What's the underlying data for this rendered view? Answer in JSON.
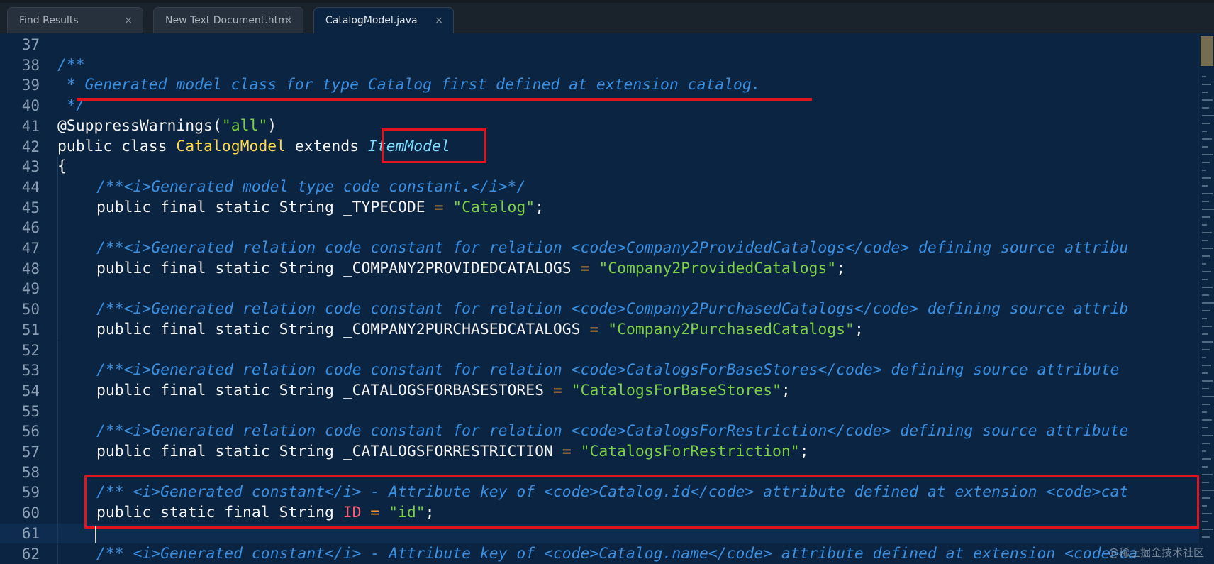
{
  "tabs": [
    {
      "label": "Find Results",
      "close": "×",
      "active": false
    },
    {
      "label": "New Text Document.html",
      "close": "×",
      "active": false
    },
    {
      "label": "CatalogModel.java",
      "close": "×",
      "active": true
    }
  ],
  "lines": [
    {
      "n": "37",
      "tokens": []
    },
    {
      "n": "38",
      "tokens": [
        {
          "t": "/**",
          "c": "c"
        }
      ]
    },
    {
      "n": "39",
      "tokens": [
        {
          "t": " * Generated model class for type Catalog first defined at extension catalog.",
          "c": "c"
        }
      ]
    },
    {
      "n": "40",
      "tokens": [
        {
          "t": " */",
          "c": "c"
        }
      ]
    },
    {
      "n": "41",
      "tokens": [
        {
          "t": "@SuppressWarnings(",
          "c": "k"
        },
        {
          "t": "\"all\"",
          "c": "s"
        },
        {
          "t": ")",
          "c": "k"
        }
      ]
    },
    {
      "n": "42",
      "tokens": [
        {
          "t": "public class ",
          "c": "k"
        },
        {
          "t": "CatalogModel",
          "c": "t"
        },
        {
          "t": " extends ",
          "c": "k"
        },
        {
          "t": "ItemModel",
          "c": "i"
        }
      ]
    },
    {
      "n": "43",
      "tokens": [
        {
          "t": "{",
          "c": "k"
        }
      ]
    },
    {
      "n": "44",
      "indent": true,
      "tokens": [
        {
          "t": "/**<i>Generated model type code constant.</i>*/",
          "c": "c"
        }
      ]
    },
    {
      "n": "45",
      "indent": true,
      "tokens": [
        {
          "t": "public final static String _TYPECODE ",
          "c": "k"
        },
        {
          "t": "=",
          "c": "o"
        },
        {
          "t": " ",
          "c": "k"
        },
        {
          "t": "\"Catalog\"",
          "c": "s"
        },
        {
          "t": ";",
          "c": "k"
        }
      ]
    },
    {
      "n": "46",
      "tokens": []
    },
    {
      "n": "47",
      "indent": true,
      "tokens": [
        {
          "t": "/**<i>Generated relation code constant for relation <code>Company2ProvidedCatalogs</code> defining source attribu",
          "c": "c"
        }
      ]
    },
    {
      "n": "48",
      "indent": true,
      "tokens": [
        {
          "t": "public final static String _COMPANY2PROVIDEDCATALOGS ",
          "c": "k"
        },
        {
          "t": "=",
          "c": "o"
        },
        {
          "t": " ",
          "c": "k"
        },
        {
          "t": "\"Company2ProvidedCatalogs\"",
          "c": "s"
        },
        {
          "t": ";",
          "c": "k"
        }
      ]
    },
    {
      "n": "49",
      "tokens": []
    },
    {
      "n": "50",
      "indent": true,
      "tokens": [
        {
          "t": "/**<i>Generated relation code constant for relation <code>Company2PurchasedCatalogs</code> defining source attrib",
          "c": "c"
        }
      ]
    },
    {
      "n": "51",
      "indent": true,
      "tokens": [
        {
          "t": "public final static String _COMPANY2PURCHASEDCATALOGS ",
          "c": "k"
        },
        {
          "t": "=",
          "c": "o"
        },
        {
          "t": " ",
          "c": "k"
        },
        {
          "t": "\"Company2PurchasedCatalogs\"",
          "c": "s"
        },
        {
          "t": ";",
          "c": "k"
        }
      ]
    },
    {
      "n": "52",
      "tokens": []
    },
    {
      "n": "53",
      "indent": true,
      "tokens": [
        {
          "t": "/**<i>Generated relation code constant for relation <code>CatalogsForBaseStores</code> defining source attribute ",
          "c": "c"
        }
      ]
    },
    {
      "n": "54",
      "indent": true,
      "tokens": [
        {
          "t": "public final static String _CATALOGSFORBASESTORES ",
          "c": "k"
        },
        {
          "t": "=",
          "c": "o"
        },
        {
          "t": " ",
          "c": "k"
        },
        {
          "t": "\"CatalogsForBaseStores\"",
          "c": "s"
        },
        {
          "t": ";",
          "c": "k"
        }
      ]
    },
    {
      "n": "55",
      "tokens": []
    },
    {
      "n": "56",
      "indent": true,
      "tokens": [
        {
          "t": "/**<i>Generated relation code constant for relation <code>CatalogsForRestriction</code> defining source attribute ",
          "c": "c"
        }
      ]
    },
    {
      "n": "57",
      "indent": true,
      "tokens": [
        {
          "t": "public final static String _CATALOGSFORRESTRICTION ",
          "c": "k"
        },
        {
          "t": "=",
          "c": "o"
        },
        {
          "t": " ",
          "c": "k"
        },
        {
          "t": "\"CatalogsForRestriction\"",
          "c": "s"
        },
        {
          "t": ";",
          "c": "k"
        }
      ]
    },
    {
      "n": "58",
      "tokens": []
    },
    {
      "n": "59",
      "indent": true,
      "tokens": [
        {
          "t": "/** <i>Generated constant</i> - Attribute key of <code>Catalog.id</code> attribute defined at extension <code>cat",
          "c": "c"
        }
      ]
    },
    {
      "n": "60",
      "indent": true,
      "tokens": [
        {
          "t": "public static final String ",
          "c": "k"
        },
        {
          "t": "ID",
          "c": "f"
        },
        {
          "t": " ",
          "c": "k"
        },
        {
          "t": "=",
          "c": "o"
        },
        {
          "t": " ",
          "c": "k"
        },
        {
          "t": "\"id\"",
          "c": "s"
        },
        {
          "t": ";",
          "c": "k"
        }
      ]
    },
    {
      "n": "61",
      "current": true,
      "tokens": []
    },
    {
      "n": "62",
      "indent": true,
      "tokens": [
        {
          "t": "/** <i>Generated constant</i> - Attribute key of <code>Catalog.name</code> attribute defined at extension <code>ca",
          "c": "c"
        }
      ]
    }
  ],
  "watermark": "@稀土掘金技术社区",
  "colors": {
    "background": "#0a2442",
    "comment": "#3a8fe0",
    "keyword": "#f4f4f4",
    "type": "#ffd84a",
    "string": "#7ecf45",
    "operator": "#ff9d2a",
    "field": "#ff5a77",
    "annotation": "#e0141c"
  }
}
